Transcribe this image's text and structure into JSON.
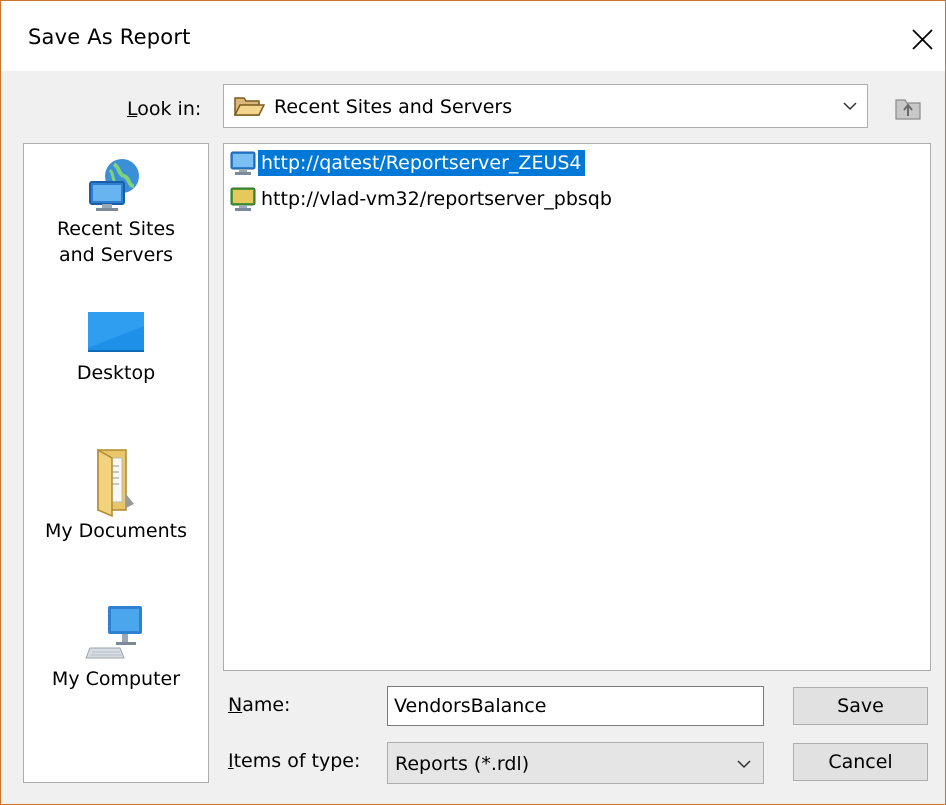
{
  "window": {
    "title": "Save As Report"
  },
  "look_in": {
    "label_underlined": "L",
    "label_rest": "ook in:",
    "value": "Recent Sites and Servers"
  },
  "places": {
    "recent_line1": "Recent Sites",
    "recent_line2": "and Servers",
    "desktop": "Desktop",
    "documents": "My Documents",
    "computer": "My Computer"
  },
  "files": [
    {
      "label": "http://qatest/Reportserver_ZEUS4",
      "selected": true
    },
    {
      "label": "http://vlad-vm32/reportserver_pbsqb",
      "selected": false
    }
  ],
  "name_field": {
    "label_underlined": "N",
    "label_rest": "ame:",
    "value": "VendorsBalance"
  },
  "type_field": {
    "label_underlined": "I",
    "label_rest": "tems of type:",
    "value": "Reports (*.rdl)"
  },
  "buttons": {
    "save": "Save",
    "cancel": "Cancel"
  },
  "colors": {
    "selection": "#0078d7",
    "title_border": "#c9732b"
  }
}
